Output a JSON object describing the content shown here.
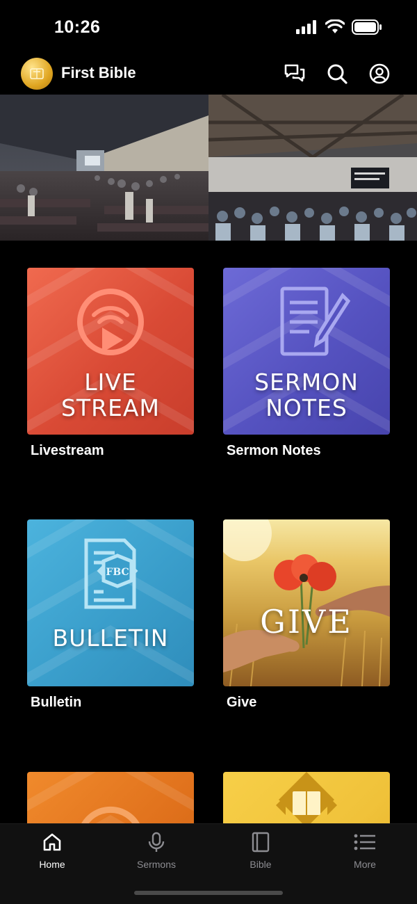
{
  "status_bar": {
    "time": "10:26"
  },
  "header": {
    "title": "First Bible",
    "icons": [
      "chat-bubbles-icon",
      "search-icon",
      "account-icon"
    ]
  },
  "tiles": [
    {
      "image_text": [
        "LIVE",
        "STREAM"
      ],
      "caption": "Livestream",
      "icon": "livestream-icon",
      "color": "#e2553d"
    },
    {
      "image_text": [
        "SERMON",
        "NOTES"
      ],
      "caption": "Sermon Notes",
      "icon": "notes-pen-icon",
      "color": "#5e5cc6"
    },
    {
      "image_text": [
        "BULLETIN"
      ],
      "caption": "Bulletin",
      "icon": "bulletin-icon",
      "emblem": "FBC",
      "color": "#3aa0cf"
    },
    {
      "image_text": [
        "GIVE"
      ],
      "caption": "Give",
      "icon": "flower-hands-icon",
      "color": "#c79a3b"
    },
    {
      "caption": "",
      "icon": "partial-icon",
      "color": "#e0711c"
    },
    {
      "caption": "",
      "icon": "bible-icon",
      "color": "#f0c23a"
    }
  ],
  "tab_bar": {
    "tabs": [
      {
        "label": "Home",
        "icon": "home-icon",
        "active": true
      },
      {
        "label": "Sermons",
        "icon": "microphone-icon",
        "active": false
      },
      {
        "label": "Bible",
        "icon": "book-icon",
        "active": false
      },
      {
        "label": "More",
        "icon": "list-icon",
        "active": false
      }
    ]
  }
}
